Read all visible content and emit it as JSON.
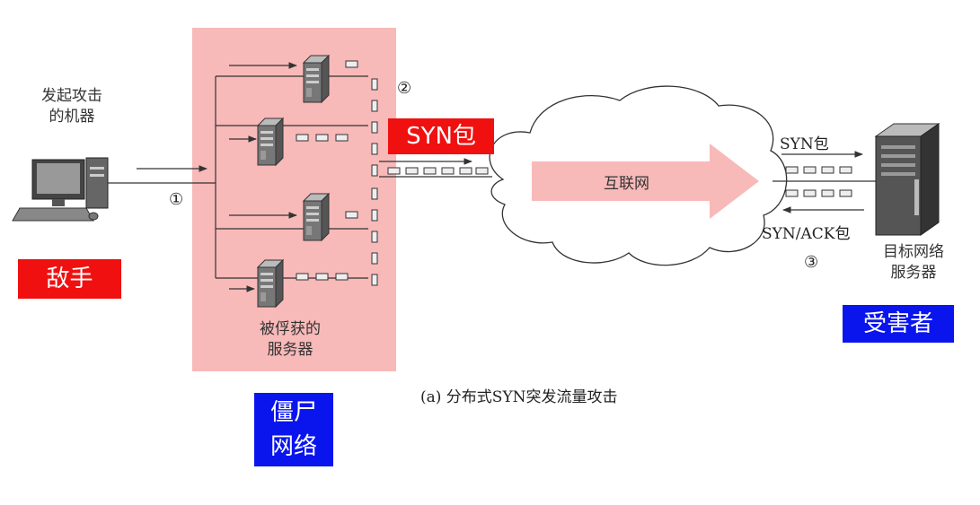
{
  "attacker": {
    "label_line1": "发起攻击",
    "label_line2": "的机器",
    "tag": "敌手"
  },
  "botnet": {
    "label_line1": "被俘获的",
    "label_line2": "服务器",
    "tag_line1": "僵尸",
    "tag_line2": "网络"
  },
  "internet": {
    "label": "互联网",
    "syn_tag": "SYN包"
  },
  "target": {
    "label_line1": "目标网络",
    "label_line2": "服务器",
    "tag": "受害者"
  },
  "flows": {
    "syn": "SYN包",
    "synack": "SYN/ACK包"
  },
  "markers": {
    "m1": "①",
    "m2": "②",
    "m3": "③"
  },
  "caption": "(a) 分布式SYN突发流量攻击",
  "colors": {
    "botnet_bg": "#f8b9b9",
    "red_tag": "#f01010",
    "blue_tag": "#0a15ee",
    "internet_arrow": "#f8b9b9"
  }
}
